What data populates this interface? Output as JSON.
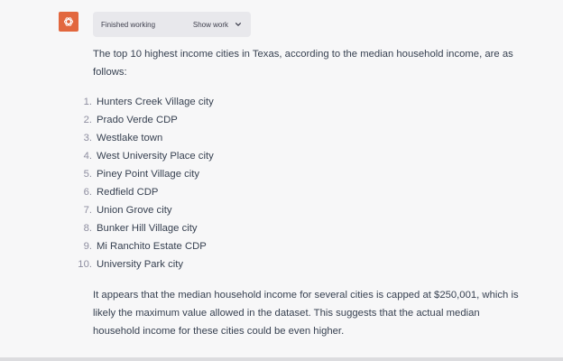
{
  "avatar": {
    "icon": "openai-logo-icon",
    "color": "#e2673e"
  },
  "status": {
    "label": "Finished working",
    "toggle_label": "Show work",
    "toggle_icon": "chevron-down-icon"
  },
  "message": {
    "intro": "The top 10 highest income cities in Texas, according to the median household income, are as follows:",
    "cities": [
      {
        "num": "1.",
        "name": "Hunters Creek Village city"
      },
      {
        "num": "2.",
        "name": "Prado Verde CDP"
      },
      {
        "num": "3.",
        "name": "Westlake town"
      },
      {
        "num": "4.",
        "name": "West University Place city"
      },
      {
        "num": "5.",
        "name": "Piney Point Village city"
      },
      {
        "num": "6.",
        "name": "Redfield CDP"
      },
      {
        "num": "7.",
        "name": "Union Grove city"
      },
      {
        "num": "8.",
        "name": "Bunker Hill Village city"
      },
      {
        "num": "9.",
        "name": "Mi Ranchito Estate CDP"
      },
      {
        "num": "10.",
        "name": "University Park city"
      }
    ],
    "outro": "It appears that the median household income for several cities is capped at $250,001, which is likely the maximum value allowed in the dataset. This suggests that the actual median household income for these cities could be even higher."
  }
}
